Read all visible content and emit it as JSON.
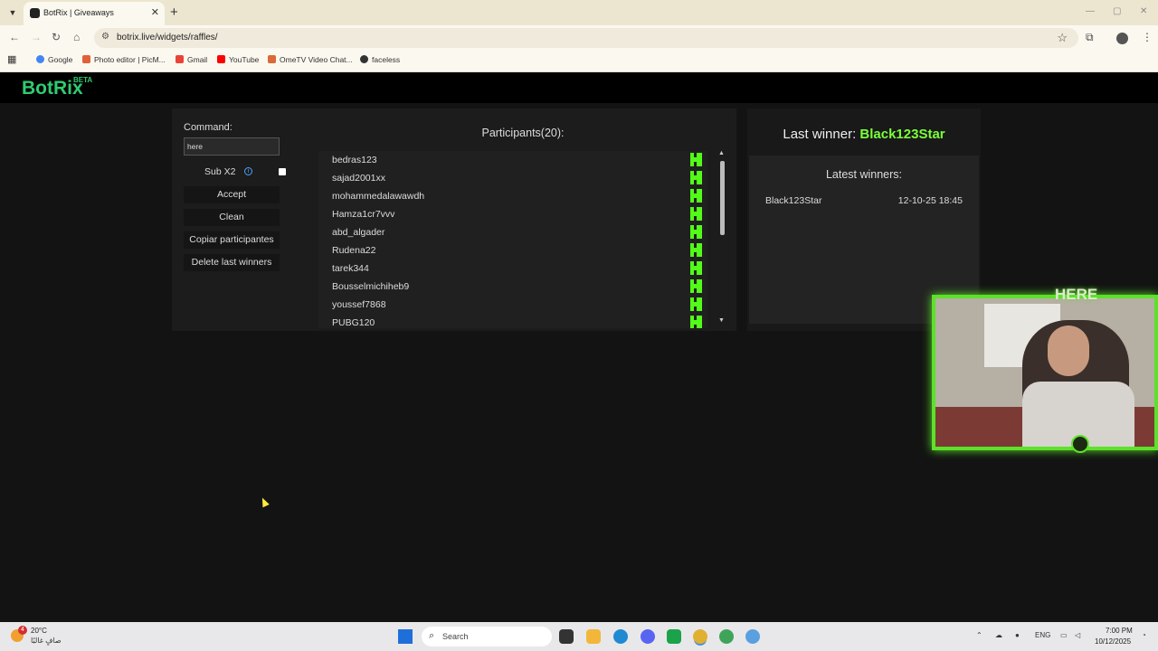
{
  "browser": {
    "tab_title": "BotRix | Giveaways",
    "url": "botrix.live/widgets/raffles/",
    "bookmarks": [
      "Google",
      "Photo editor | PicM...",
      "Gmail",
      "YouTube",
      "OmeTV Video Chat...",
      "faceless"
    ]
  },
  "site": {
    "logo": "BotRix",
    "logo_badge": "BETA"
  },
  "raffle": {
    "command_label": "Command:",
    "command_value": "here",
    "sub_label": "Sub X2",
    "buttons": {
      "accept": "Accept",
      "clean": "Clean",
      "copy": "Copiar participantes",
      "delete": "Delete last winners"
    },
    "participants_title": "Participants(20):",
    "participants": [
      "bedras123",
      "sajad2001xx",
      "mohammedalawawdh",
      "Hamza1cr7vvv",
      "abd_algader",
      "Rudena22",
      "tarek344",
      "Bousselmichiheb9",
      "youssef7868",
      "PUBG120"
    ]
  },
  "winners": {
    "last_winner_label": "Last winner:",
    "last_winner_name": "Black123Star",
    "latest_title": "Latest winners:",
    "list": [
      {
        "name": "Black123Star",
        "date": "12-10-25 18:45"
      }
    ]
  },
  "webcam": {
    "banner": "HERE"
  },
  "taskbar": {
    "weather_badge": "4",
    "weather_temp": "20°C",
    "weather_desc": "صافٍ غالبًا",
    "search_placeholder": "Search",
    "lang": "ENG",
    "time": "7:00 PM",
    "date": "10/12/2025"
  }
}
